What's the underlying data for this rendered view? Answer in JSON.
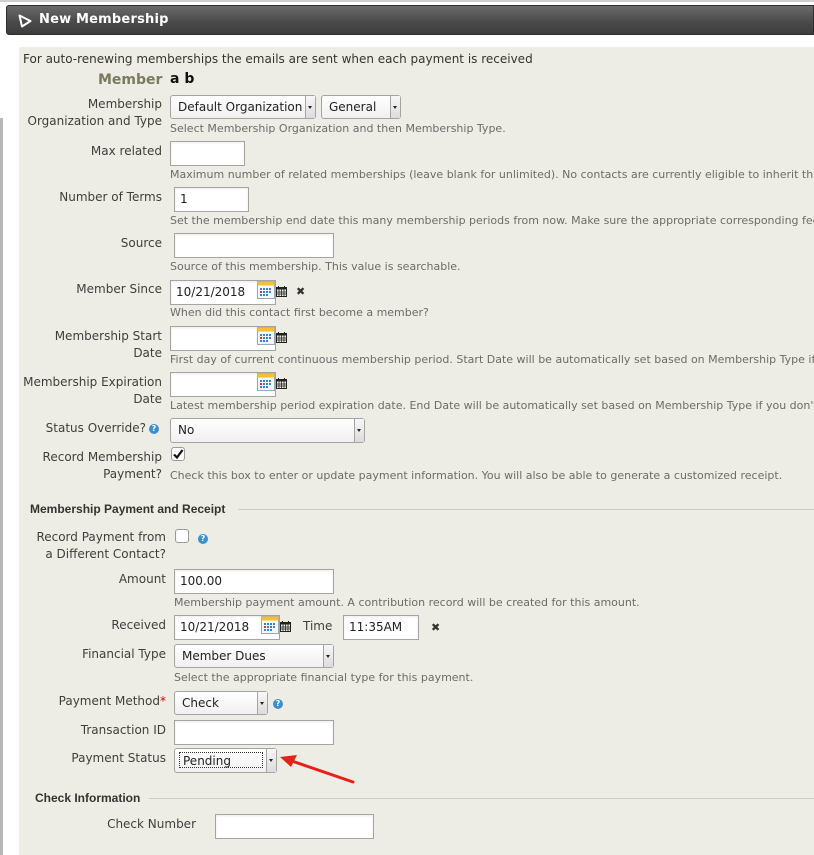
{
  "header": {
    "title": "New Membership",
    "icon": "triangle-icon"
  },
  "notice": "For auto-renewing memberships the emails are sent when each payment is received",
  "member": {
    "label": "Member",
    "value": "a b"
  },
  "membership_org_type": {
    "label_line1": "Membership",
    "label_line2": "Organization and Type",
    "org_value": "Default Organization",
    "type_value": "General",
    "help": "Select Membership Organization and then Membership Type."
  },
  "max_related": {
    "label": "Max related",
    "value": "",
    "help": "Maximum number of related memberships (leave blank for unlimited). No contacts are currently eligible to inherit this rela"
  },
  "num_terms": {
    "label": "Number of Terms",
    "value": "1",
    "help": "Set the membership end date this many membership periods from now. Make sure the appropriate corresponding fee is e"
  },
  "source": {
    "label": "Source",
    "value": "",
    "help": "Source of this membership. This value is searchable."
  },
  "member_since": {
    "label": "Member Since",
    "value": "10/21/2018",
    "help": "When did this contact first become a member?"
  },
  "start_date": {
    "label_line1": "Membership Start",
    "label_line2": "Date",
    "value": "",
    "help": "First day of current continuous membership period. Start Date will be automatically set based on Membership Type if you"
  },
  "expiration_date": {
    "label_line1": "Membership Expiration",
    "label_line2": "Date",
    "value": "",
    "help": "Latest membership period expiration date. End Date will be automatically set based on Membership Type if you don't sele"
  },
  "status_override": {
    "label": "Status Override?",
    "value": "No"
  },
  "record_payment": {
    "label_line1": "Record Membership",
    "label_line2": "Payment?",
    "checked": true,
    "help": "Check this box to enter or update payment information. You will also be able to generate a customized receipt."
  },
  "payment_section": {
    "title": "Membership Payment and Receipt",
    "different_contact": {
      "label_line1": "Record Payment from",
      "label_line2": "a Different Contact?",
      "checked": false
    },
    "amount": {
      "label": "Amount",
      "value": "100.00",
      "help": "Membership payment amount. A contribution record will be created for this amount."
    },
    "received": {
      "label": "Received",
      "date_value": "10/21/2018",
      "time_label": "Time",
      "time_value": "11:35AM"
    },
    "financial_type": {
      "label": "Financial Type",
      "value": "Member Dues",
      "help": "Select the appropriate financial type for this payment."
    },
    "payment_method": {
      "label": "Payment Method",
      "required_mark": "*",
      "value": "Check"
    },
    "transaction_id": {
      "label": "Transaction ID",
      "value": ""
    },
    "payment_status": {
      "label": "Payment Status",
      "value": "Pending"
    }
  },
  "check_section": {
    "title": "Check Information",
    "check_number": {
      "label": "Check Number",
      "value": ""
    }
  },
  "colors": {
    "header_bg": "#4b4b4b",
    "panel_bg": "#eeede5",
    "annotation_arrow": "#e8201c",
    "help_icon": "#3b8fcf",
    "member_label": "#7a7a5e"
  }
}
